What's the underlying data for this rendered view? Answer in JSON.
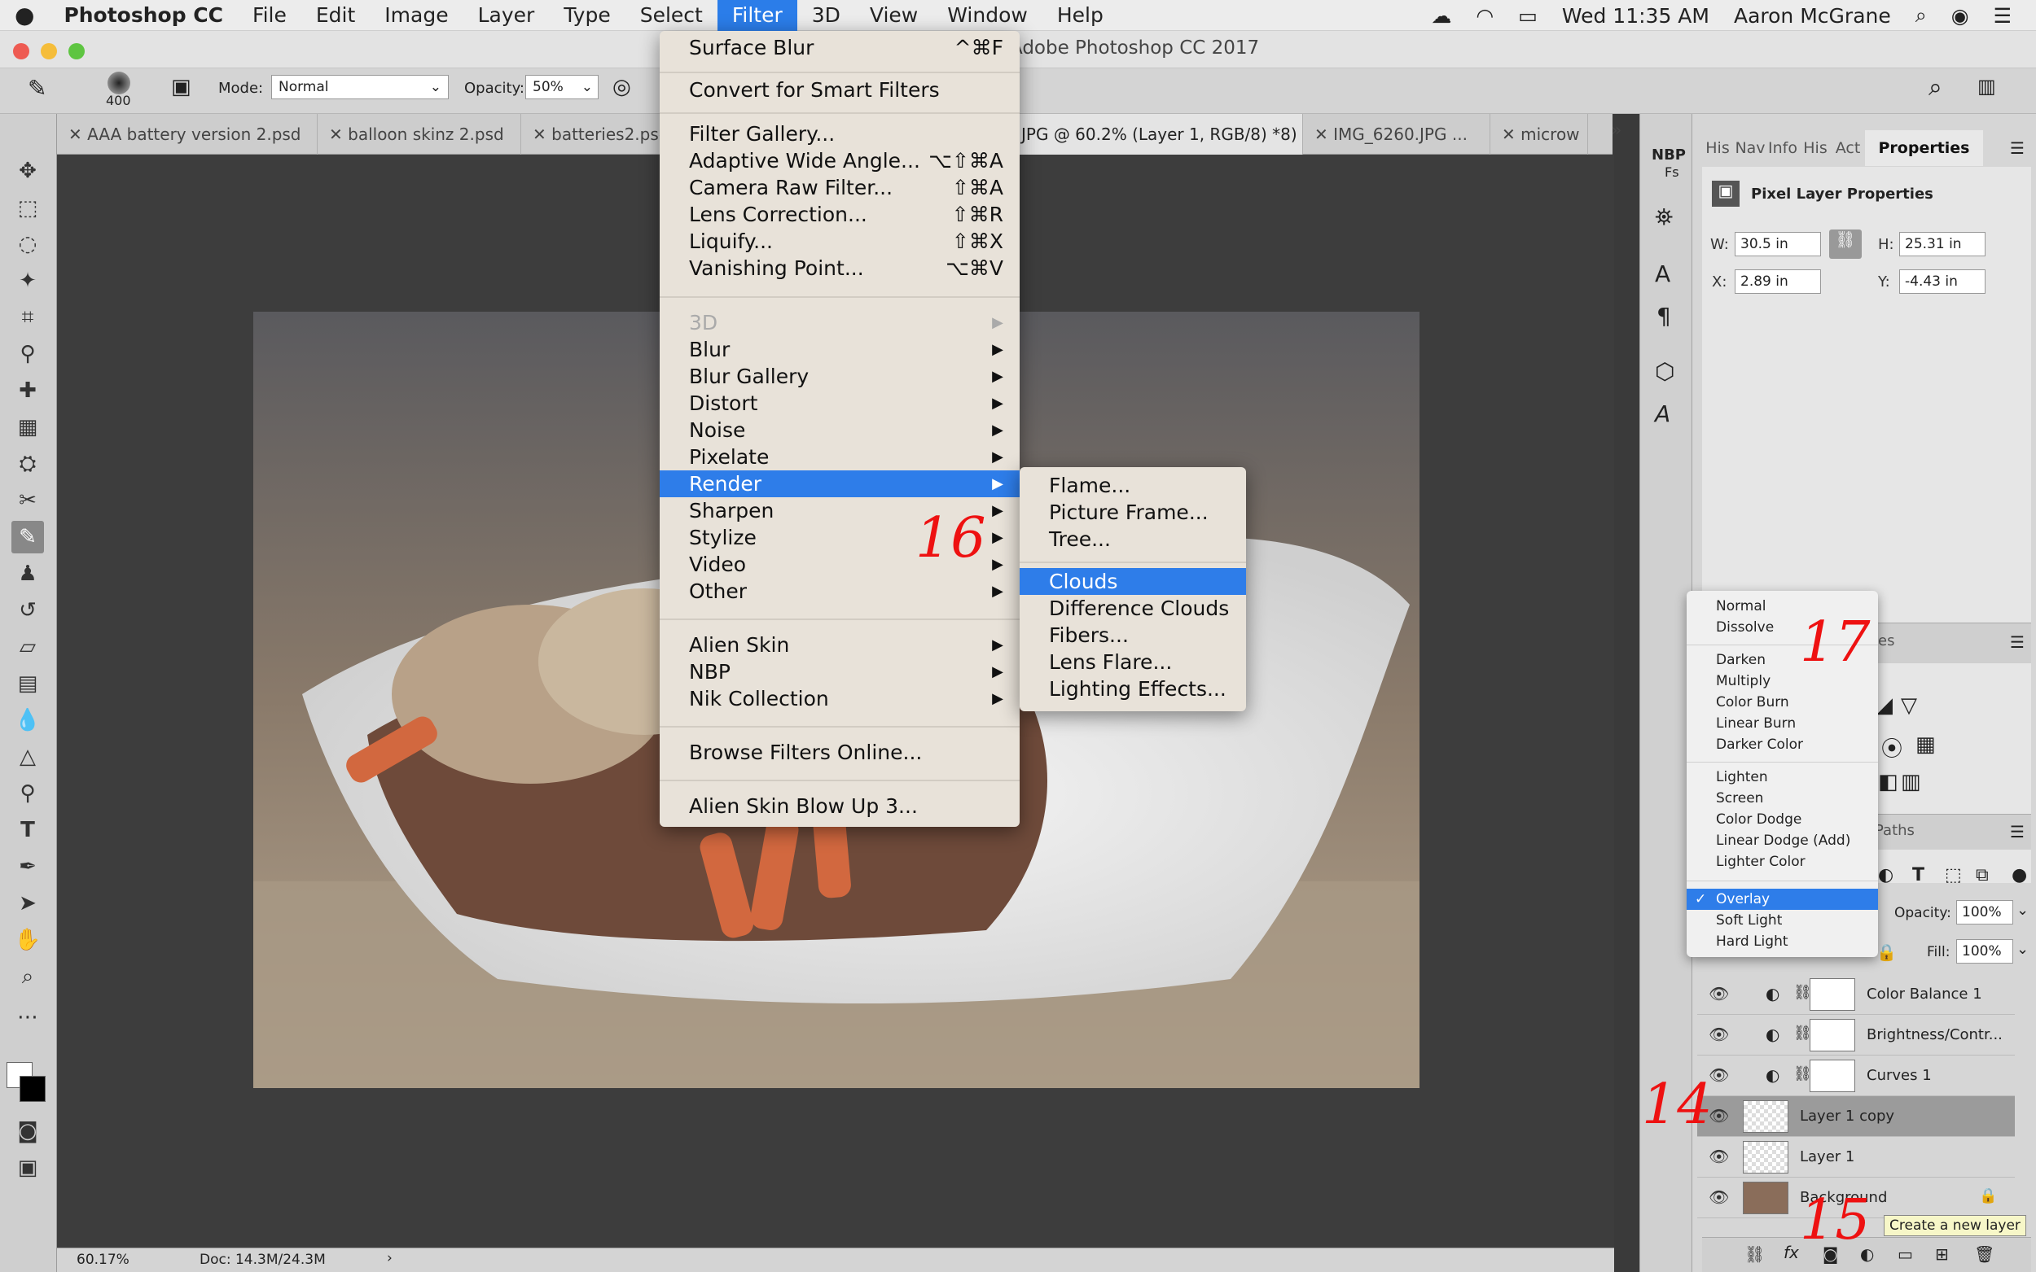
{
  "menubar": {
    "app": "Photoshop CC",
    "items": [
      "File",
      "Edit",
      "Image",
      "Layer",
      "Type",
      "Select",
      "Filter",
      "3D",
      "View",
      "Window",
      "Help"
    ],
    "clock": "Wed 11:35 AM",
    "user": "Aaron McGrane"
  },
  "window": {
    "title": "Adobe Photoshop CC 2017"
  },
  "options": {
    "brush_size": "400",
    "mode_label": "Mode:",
    "mode_value": "Normal",
    "opacity_label": "Opacity:",
    "opacity_value": "50%"
  },
  "tabs": [
    "AAA battery version 2.psd",
    "balloon skinz 2.psd",
    "batteries2.psd",
    "JPG @ 60.2% (Layer 1, RGB/8) *8) *",
    "IMG_6260.JPG ...",
    "microw"
  ],
  "status": {
    "zoom": "60.17%",
    "doc": "Doc: 14.3M/24.3M"
  },
  "filter_menu": {
    "items": [
      {
        "label": "Surface Blur",
        "shortcut": "^⌘F"
      },
      {
        "label": "Convert for Smart Filters"
      },
      {
        "label": "Filter Gallery..."
      },
      {
        "label": "Adaptive Wide Angle...",
        "shortcut": "⌥⇧⌘A"
      },
      {
        "label": "Camera Raw Filter...",
        "shortcut": "⇧⌘A"
      },
      {
        "label": "Lens Correction...",
        "shortcut": "⇧⌘R"
      },
      {
        "label": "Liquify...",
        "shortcut": "⇧⌘X"
      },
      {
        "label": "Vanishing Point...",
        "shortcut": "⌥⌘V"
      },
      {
        "label": "3D"
      },
      {
        "label": "Blur"
      },
      {
        "label": "Blur Gallery"
      },
      {
        "label": "Distort"
      },
      {
        "label": "Noise"
      },
      {
        "label": "Pixelate"
      },
      {
        "label": "Render"
      },
      {
        "label": "Sharpen"
      },
      {
        "label": "Stylize"
      },
      {
        "label": "Video"
      },
      {
        "label": "Other"
      },
      {
        "label": "Alien Skin"
      },
      {
        "label": "NBP"
      },
      {
        "label": "Nik Collection"
      },
      {
        "label": "Browse Filters Online..."
      },
      {
        "label": "Alien Skin Blow Up 3..."
      }
    ]
  },
  "render_menu": {
    "items": [
      "Flame...",
      "Picture Frame...",
      "Tree...",
      "Clouds",
      "Difference Clouds",
      "Fibers...",
      "Lens Flare...",
      "Lighting Effects..."
    ]
  },
  "properties": {
    "tabs": [
      "His",
      "Nav",
      "Info",
      "His",
      "Act",
      "Properties"
    ],
    "title": "Pixel Layer Properties",
    "w_label": "W:",
    "w": "30.5 in",
    "h_label": "H:",
    "h": "25.31 in",
    "x_label": "X:",
    "x": "2.89 in",
    "y_label": "Y:",
    "y": "-4.43 in"
  },
  "blend_modes": [
    "Normal",
    "Dissolve",
    "Darken",
    "Multiply",
    "Color Burn",
    "Linear Burn",
    "Darker Color",
    "Lighten",
    "Screen",
    "Color Dodge",
    "Linear Dodge (Add)",
    "Lighter Color",
    "Overlay",
    "Soft Light",
    "Hard Light"
  ],
  "layers_panel": {
    "paths_tab": "Paths",
    "styles_tab": "es",
    "opacity_label": "Opacity:",
    "opacity": "100%",
    "fill_label": "Fill:",
    "fill": "100%",
    "layers": [
      "Color Balance 1",
      "Brightness/Contr...",
      "Curves 1",
      "Layer 1 copy",
      "Layer 1",
      "Background"
    ]
  },
  "iconstrip": {
    "nbp": "NBP",
    "fs": "Fs"
  },
  "annotations": [
    "16",
    "17",
    "14",
    "15"
  ],
  "tooltip": "Create a new layer"
}
